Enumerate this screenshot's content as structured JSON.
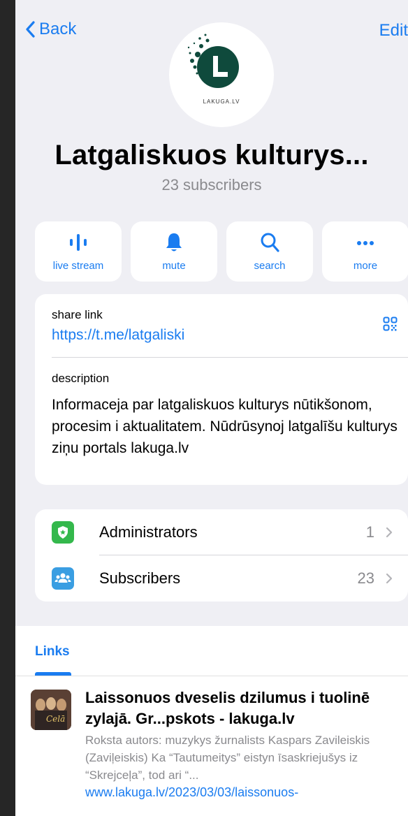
{
  "header": {
    "back_label": "Back",
    "edit_label": "Edit"
  },
  "avatar": {
    "logo_text": "LAKUGA.LV"
  },
  "channel": {
    "title": "Latgaliskuos kulturys...",
    "subscribers": "23 subscribers"
  },
  "actions": [
    {
      "label": "live stream",
      "icon": "live-stream-icon"
    },
    {
      "label": "mute",
      "icon": "bell-icon"
    },
    {
      "label": "search",
      "icon": "search-icon"
    },
    {
      "label": "more",
      "icon": "more-icon"
    }
  ],
  "info": {
    "share_link_caption": "share link",
    "share_link": "https://t.me/latgaliski",
    "description_caption": "description",
    "description": "Informaceja par latgaliskuos kulturys nūtikšonom, procesim i aktualitatem. Nūdrūsynoj latgalīšu kulturys ziņu portals lakuga.lv"
  },
  "rows": [
    {
      "label": "Administrators",
      "count": "1",
      "icon": "shield-star-icon",
      "color": "#34b84c"
    },
    {
      "label": "Subscribers",
      "count": "23",
      "icon": "people-icon",
      "color": "#3a9ee2"
    }
  ],
  "links_section": {
    "tab_label": "Links",
    "item": {
      "title": "Laissonuos dveselis dzilumus i tuolinē zylajā. Gr...pskots - lakuga.lv",
      "description": "Roksta autors: muzykys žurnalists Kaspars Zavileiskis (Zaviļeiskis) Ka “Tautumeitys” eistyn īsaskriejušys iz “Skrejceļa”, tod ari “...",
      "url": "www.lakuga.lv/2023/03/03/laissonuos-"
    }
  },
  "colors": {
    "accent": "#1a7cf0",
    "background": "#efeff4",
    "logo_green": "#0f4a3c"
  }
}
